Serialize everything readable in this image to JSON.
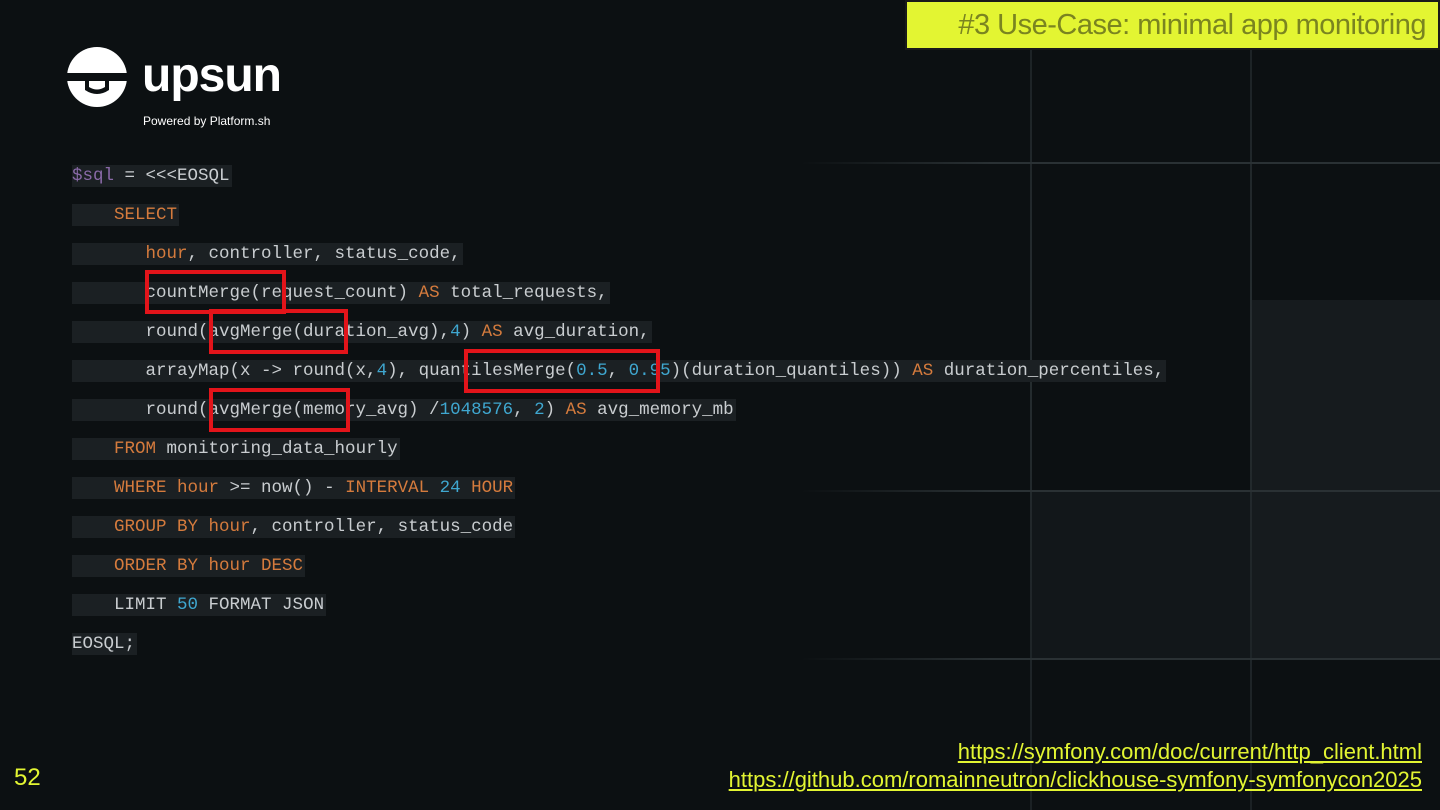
{
  "slide": {
    "title": "#3 Use-Case: minimal app monitoring",
    "page_number": "52"
  },
  "logo": {
    "wordmark": "upsun",
    "tagline": "Powered by Platform.sh"
  },
  "code": {
    "lines": [
      "$sql = <<<EOSQL",
      "    SELECT",
      "       hour, controller, status_code,",
      "       countMerge(request_count) AS total_requests,",
      "       round(avgMerge(duration_avg),4) AS avg_duration,",
      "       arrayMap(x -> round(x,4), quantilesMerge(0.5, 0.95)(duration_quantiles)) AS duration_percentiles,",
      "       round(avgMerge(memory_avg) /1048576, 2) AS avg_memory_mb",
      "    FROM monitoring_data_hourly",
      "    WHERE hour >= now() - INTERVAL 24 HOUR",
      "    GROUP BY hour, controller, status_code",
      "    ORDER BY hour DESC",
      "    LIMIT 50 FORMAT JSON",
      "EOSQL;"
    ],
    "highlighted_functions": [
      "countMerge",
      "avgMerge",
      "quantilesMerge",
      "avgMerge"
    ]
  },
  "links": [
    "https://symfony.com/doc/current/http_client.html",
    "https://github.com/romainneutron/clickhouse-symfony-symfonycon2025"
  ],
  "colors": {
    "accent": "#e3f532",
    "highlight_border": "#e2141a",
    "keyword": "#d57b3d",
    "number": "#3fa7d0",
    "background": "#0c1012"
  },
  "icons": {
    "logo_mark": "upsun-logo-icon"
  }
}
